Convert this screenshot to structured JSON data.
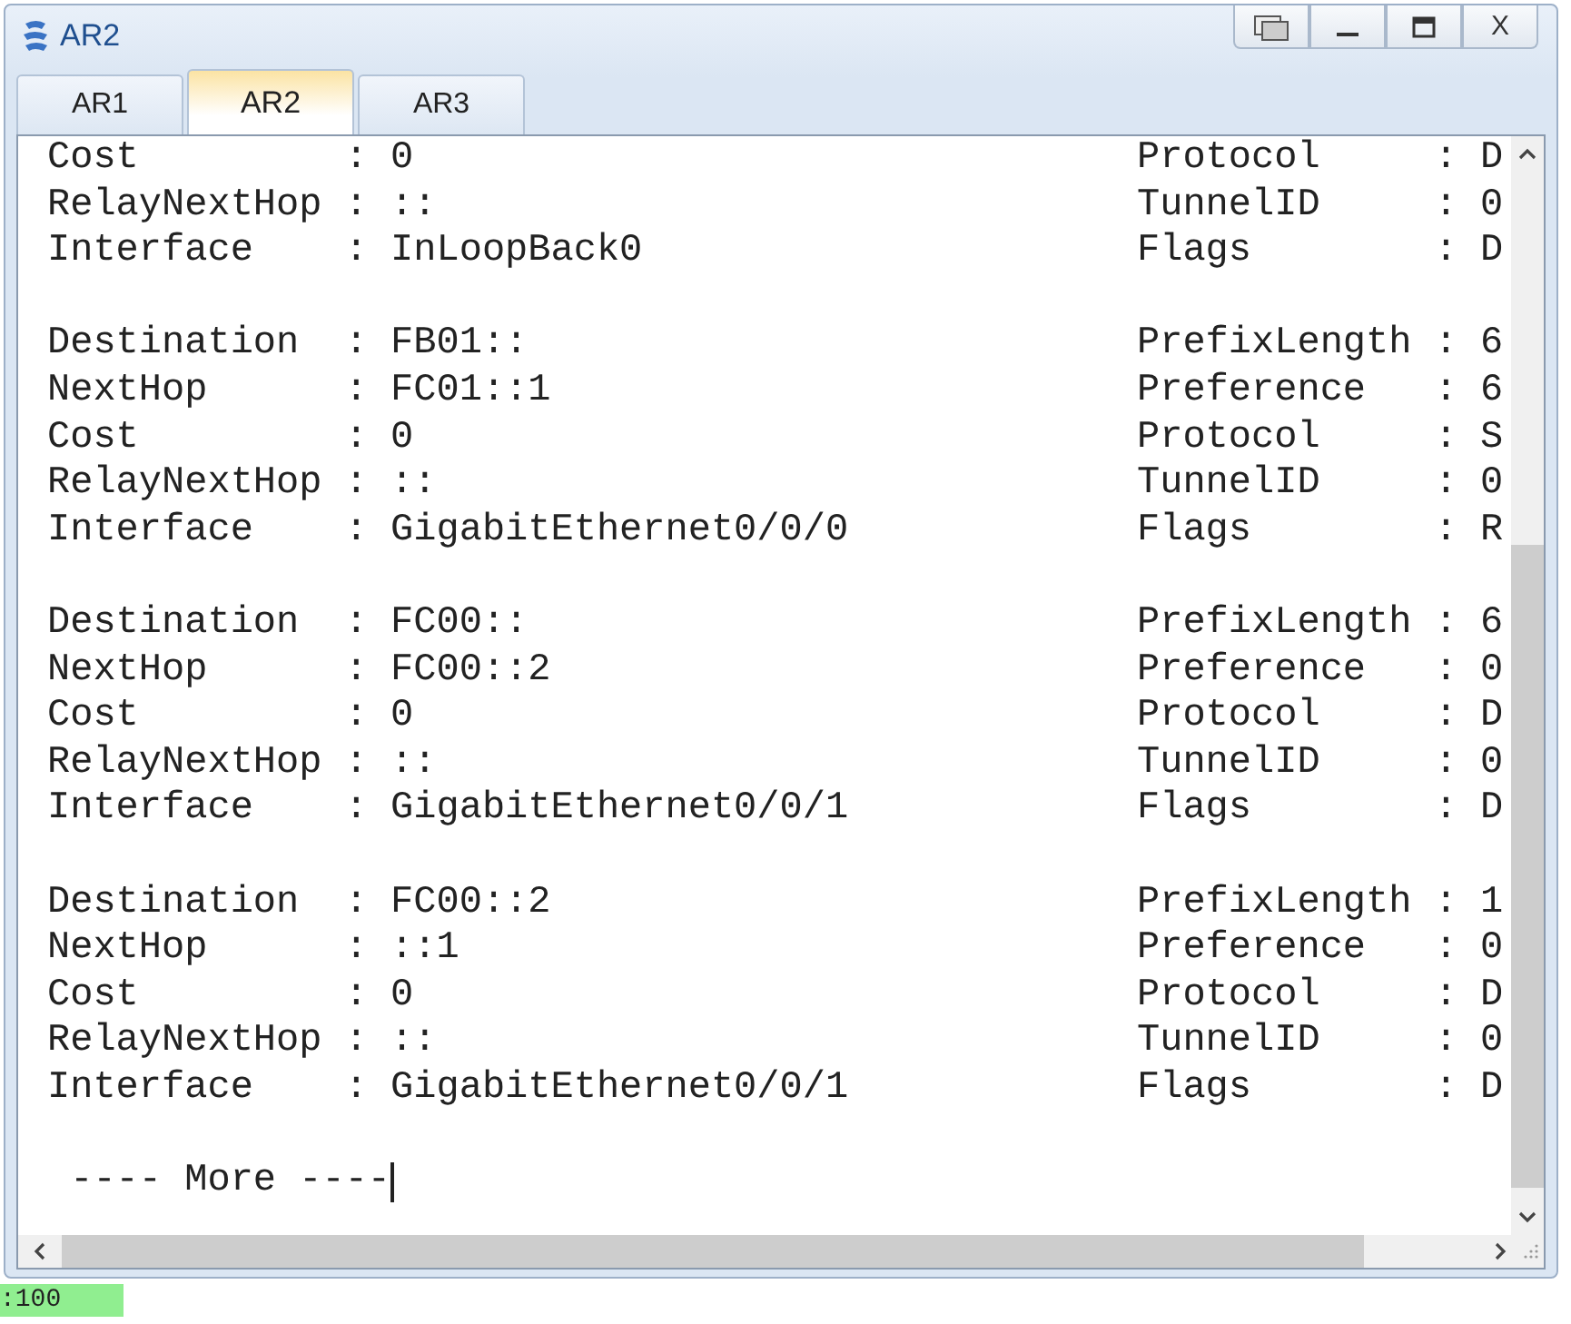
{
  "window": {
    "title": "AR2",
    "close_label": "X"
  },
  "tabs": [
    {
      "label": "AR1",
      "selected": false
    },
    {
      "label": "AR2",
      "selected": true
    },
    {
      "label": "AR3",
      "selected": false
    }
  ],
  "terminal": {
    "groups": [
      [
        {
          "left": "Cost         : 0",
          "right": "Protocol     : D"
        },
        {
          "left": "RelayNextHop : ::",
          "right": "TunnelID     : 0"
        },
        {
          "left": "Interface    : InLoopBack0",
          "right": "Flags        : D"
        }
      ],
      [
        {
          "left": "Destination  : FB01::",
          "right": "PrefixLength : 6"
        },
        {
          "left": "NextHop      : FC01::1",
          "right": "Preference   : 6"
        },
        {
          "left": "Cost         : 0",
          "right": "Protocol     : S"
        },
        {
          "left": "RelayNextHop : ::",
          "right": "TunnelID     : 0"
        },
        {
          "left": "Interface    : GigabitEthernet0/0/0",
          "right": "Flags        : R"
        }
      ],
      [
        {
          "left": "Destination  : FC00::",
          "right": "PrefixLength : 6"
        },
        {
          "left": "NextHop      : FC00::2",
          "right": "Preference   : 0"
        },
        {
          "left": "Cost         : 0",
          "right": "Protocol     : D"
        },
        {
          "left": "RelayNextHop : ::",
          "right": "TunnelID     : 0"
        },
        {
          "left": "Interface    : GigabitEthernet0/0/1",
          "right": "Flags        : D"
        }
      ],
      [
        {
          "left": "Destination  : FC00::2",
          "right": "PrefixLength : 1"
        },
        {
          "left": "NextHop      : ::1",
          "right": "Preference   : 0"
        },
        {
          "left": "Cost         : 0",
          "right": "Protocol     : D"
        },
        {
          "left": "RelayNextHop : ::",
          "right": "TunnelID     : 0"
        },
        {
          "left": "Interface    : GigabitEthernet0/0/1",
          "right": "Flags        : D"
        }
      ]
    ],
    "prompt": " ---- More ----"
  },
  "status": ":100"
}
